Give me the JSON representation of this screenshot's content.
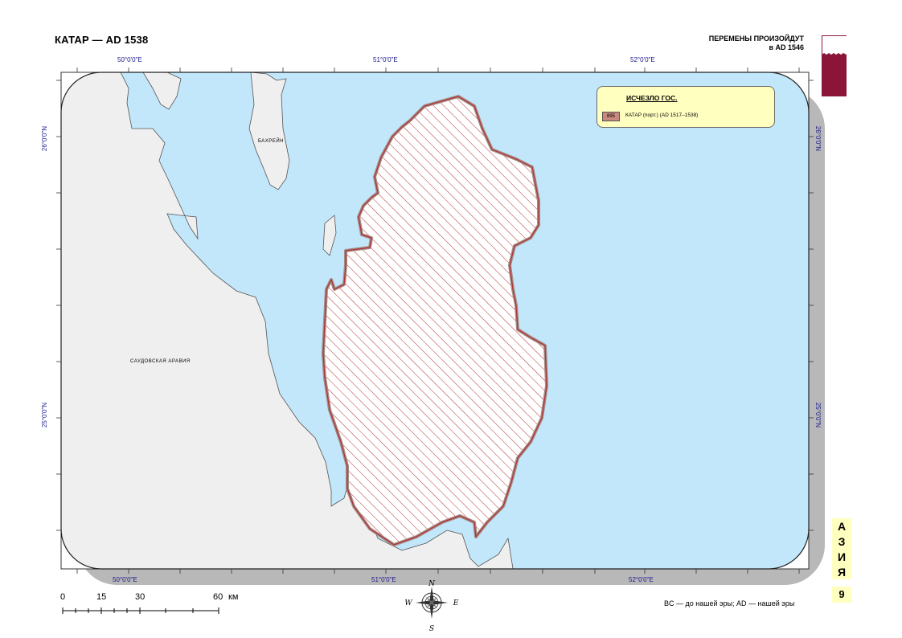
{
  "header": {
    "title": "КАТАР — AD 1538",
    "change_line1": "ПЕРЕМЕНЫ ПРОИЗОЙДУТ",
    "change_line2": "в AD 1546"
  },
  "colors": {
    "sea": "#c2e6fa",
    "land": "#efefef",
    "state_hatch": "#b03232",
    "state_outline": "#a58b87",
    "legend_bg": "#ffffc0",
    "flag_maroon": "#8a1538",
    "grid_text": "#1a1a8c",
    "shadow": "#b8b8b8"
  },
  "grid_labels": {
    "top": [
      "50°0'0\"E",
      "51°0'0\"E",
      "52°0'0\"E"
    ],
    "bottom": [
      "50°0'0\"E",
      "51°0'0\"E",
      "52°0'0\"E"
    ],
    "left": [
      "26°0'0\"N",
      "25°0'0\"N"
    ],
    "right": [
      "26°0'0\"N",
      "25°0'0\"N"
    ]
  },
  "places": {
    "bahrain": "БАХРЕЙН",
    "saudi": "САУДОВСКАЯ АРАВИЯ"
  },
  "legend": {
    "title": "ИСЧЕЗЛО ГОС.",
    "code": "895",
    "label": "КАТАР (порт.) (AD 1517–1538)"
  },
  "region_tab": {
    "letters": [
      "А",
      "З",
      "И",
      "Я"
    ],
    "page": "9"
  },
  "scale_bar": {
    "ticks": [
      "0",
      "15",
      "30",
      "60"
    ],
    "unit": "км"
  },
  "compass": {
    "n": "N",
    "s": "S",
    "e": "E",
    "w": "W"
  },
  "era_note": "BC — до нашей эры; AD — нашей эры"
}
